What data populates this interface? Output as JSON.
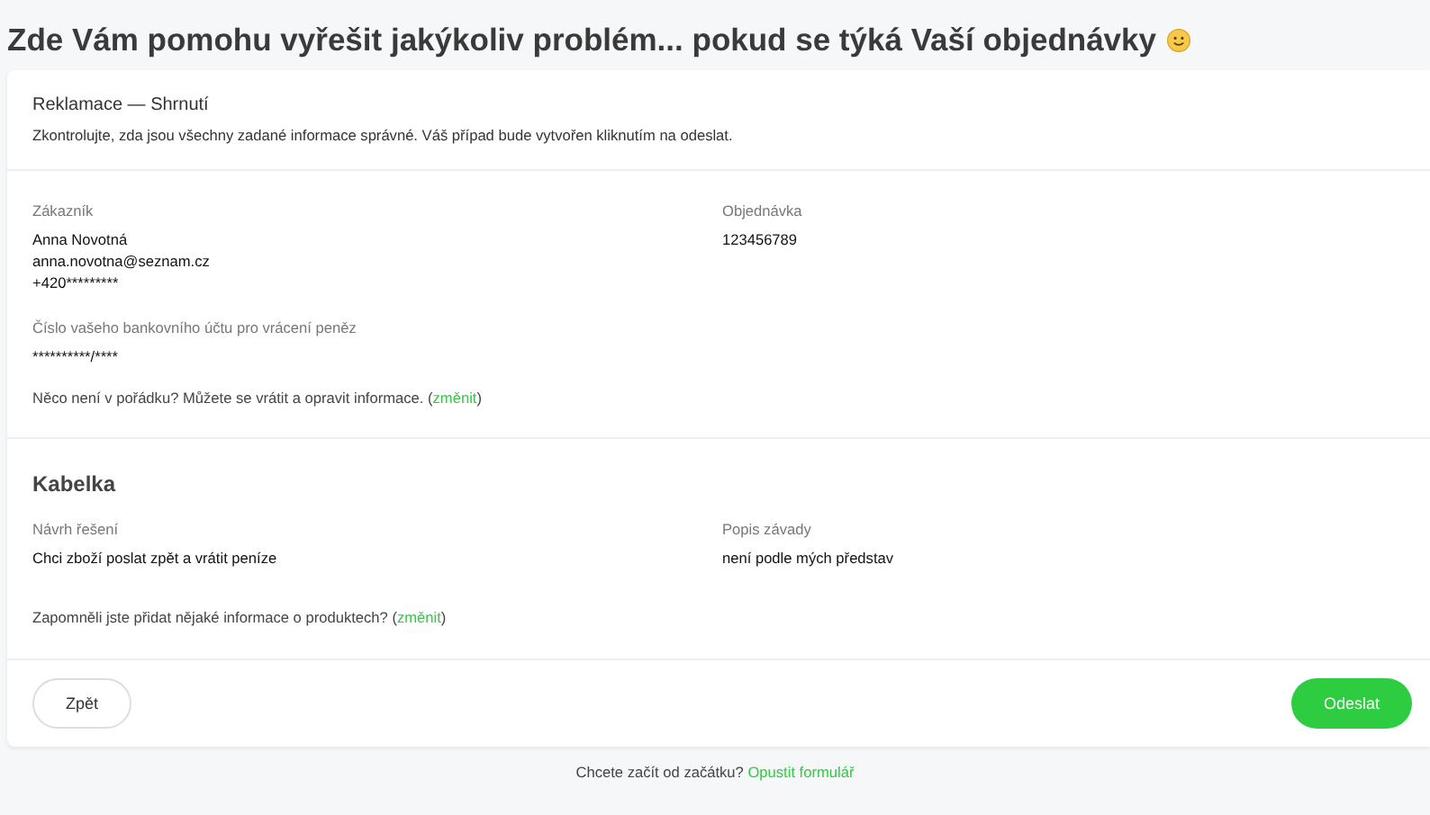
{
  "title": "Zde Vám pomohu vyřešit jakýkoliv problém... pokud se týká Vaší objednávky",
  "summary": {
    "heading": "Reklamace — Shrnutí",
    "text": "Zkontrolujte, zda jsou všechny zadané informace správné. Váš případ bude vytvořen kliknutím na odeslat."
  },
  "customer": {
    "label": "Zákazník",
    "lines": [
      "Anna Novotná",
      "anna.novotna@seznam.cz",
      "+420*********"
    ]
  },
  "order": {
    "label": "Objednávka",
    "value": "123456789"
  },
  "bank": {
    "label": "Číslo vašeho bankovního účtu pro vrácení peněz",
    "value": "**********/****"
  },
  "customer_note": {
    "text": "Něco není v pořádku? Můžete se vrátit a opravit informace. (",
    "link": "změnit",
    "end": ")"
  },
  "product": {
    "name": "Kabelka",
    "fields": [
      {
        "label": "Návrh řešení",
        "value": "Chci zboží poslat zpět a vrátit peníze"
      },
      {
        "label": "Popis závady",
        "value": "není podle mých představ"
      }
    ],
    "note": {
      "text": "Zapomněli jste přidat nějaké informace o produktech? (",
      "link": "změnit",
      "end": ")"
    }
  },
  "buttons": [
    {
      "kind": "secondary",
      "label": "Zpět"
    },
    {
      "kind": "primary",
      "label": "Odeslat"
    }
  ],
  "footer": {
    "text": "Chcete začít od začátku?",
    "link": "Opustit formulář"
  }
}
